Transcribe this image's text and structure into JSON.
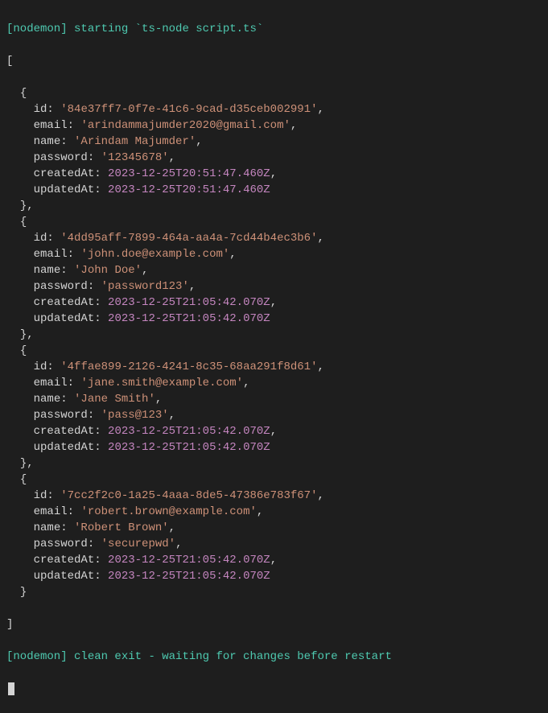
{
  "header": {
    "starting_prefix": "[nodemon]",
    "starting_text": " starting `ts-node script.ts`"
  },
  "records": [
    {
      "id": "'84e37ff7-0f7e-41c6-9cad-d35ceb002991'",
      "email": "'arindammajumder2020@gmail.com'",
      "name": "'Arindam Majumder'",
      "password": "'12345678'",
      "createdAt": "2023-12-25T20:51:47.460Z",
      "updatedAt": "2023-12-25T20:51:47.460Z"
    },
    {
      "id": "'4dd95aff-7899-464a-aa4a-7cd44b4ec3b6'",
      "email": "'john.doe@example.com'",
      "name": "'John Doe'",
      "password": "'password123'",
      "createdAt": "2023-12-25T21:05:42.070Z",
      "updatedAt": "2023-12-25T21:05:42.070Z"
    },
    {
      "id": "'4ffae899-2126-4241-8c35-68aa291f8d61'",
      "email": "'jane.smith@example.com'",
      "name": "'Jane Smith'",
      "password": "'pass@123'",
      "createdAt": "2023-12-25T21:05:42.070Z",
      "updatedAt": "2023-12-25T21:05:42.070Z"
    },
    {
      "id": "'7cc2f2c0-1a25-4aaa-8de5-47386e783f67'",
      "email": "'robert.brown@example.com'",
      "name": "'Robert Brown'",
      "password": "'securepwd'",
      "createdAt": "2023-12-25T21:05:42.070Z",
      "updatedAt": "2023-12-25T21:05:42.070Z"
    }
  ],
  "labels": {
    "id": "id",
    "email": "email",
    "name": "name",
    "password": "password",
    "createdAt": "createdAt",
    "updatedAt": "updatedAt"
  },
  "footer": {
    "exit_prefix": "[nodemon]",
    "exit_text": " clean exit - waiting for changes before restart"
  }
}
